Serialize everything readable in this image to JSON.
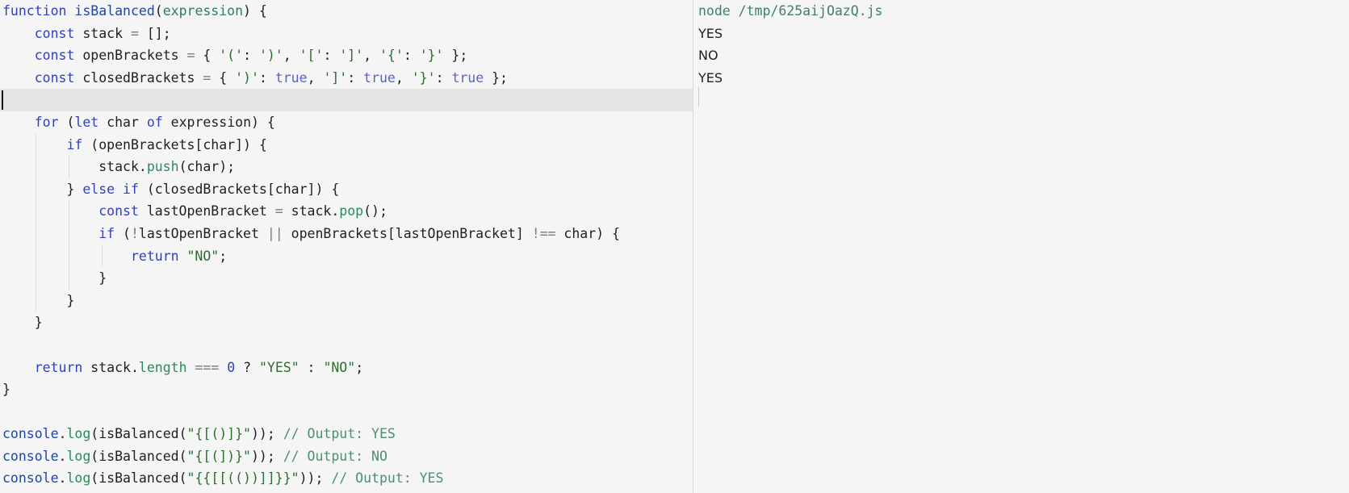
{
  "editor": {
    "lines": [
      [
        [
          "kw",
          "function"
        ],
        [
          "plain",
          " "
        ],
        [
          "fn",
          "isBalanced"
        ],
        [
          "plain",
          "("
        ],
        [
          "param",
          "expression"
        ],
        [
          "plain",
          ") {"
        ]
      ],
      [
        [
          "plain",
          "    "
        ],
        [
          "kw",
          "const"
        ],
        [
          "plain",
          " stack "
        ],
        [
          "op",
          "="
        ],
        [
          "plain",
          " [];"
        ]
      ],
      [
        [
          "plain",
          "    "
        ],
        [
          "kw",
          "const"
        ],
        [
          "plain",
          " openBrackets "
        ],
        [
          "op",
          "="
        ],
        [
          "plain",
          " { "
        ],
        [
          "str",
          "'('"
        ],
        [
          "plain",
          ": "
        ],
        [
          "str",
          "')'"
        ],
        [
          "plain",
          ", "
        ],
        [
          "str",
          "'['"
        ],
        [
          "plain",
          ": "
        ],
        [
          "str",
          "']'"
        ],
        [
          "plain",
          ", "
        ],
        [
          "str",
          "'{'"
        ],
        [
          "plain",
          ": "
        ],
        [
          "str",
          "'}'"
        ],
        [
          "plain",
          " };"
        ]
      ],
      [
        [
          "plain",
          "    "
        ],
        [
          "kw",
          "const"
        ],
        [
          "plain",
          " closedBrackets "
        ],
        [
          "op",
          "="
        ],
        [
          "plain",
          " { "
        ],
        [
          "str",
          "')'"
        ],
        [
          "plain",
          ": "
        ],
        [
          "bool",
          "true"
        ],
        [
          "plain",
          ", "
        ],
        [
          "str",
          "']'"
        ],
        [
          "plain",
          ": "
        ],
        [
          "bool",
          "true"
        ],
        [
          "plain",
          ", "
        ],
        [
          "str",
          "'}'"
        ],
        [
          "plain",
          ": "
        ],
        [
          "bool",
          "true"
        ],
        [
          "plain",
          " };"
        ]
      ],
      [],
      [
        [
          "plain",
          "    "
        ],
        [
          "kw",
          "for"
        ],
        [
          "plain",
          " ("
        ],
        [
          "kw",
          "let"
        ],
        [
          "plain",
          " char "
        ],
        [
          "kw",
          "of"
        ],
        [
          "plain",
          " expression) {"
        ]
      ],
      [
        [
          "plain",
          "        "
        ],
        [
          "kw",
          "if"
        ],
        [
          "plain",
          " (openBrackets[char]) {"
        ]
      ],
      [
        [
          "plain",
          "            stack."
        ],
        [
          "prop",
          "push"
        ],
        [
          "plain",
          "(char);"
        ]
      ],
      [
        [
          "plain",
          "        } "
        ],
        [
          "kw",
          "else"
        ],
        [
          "plain",
          " "
        ],
        [
          "kw",
          "if"
        ],
        [
          "plain",
          " (closedBrackets[char]) {"
        ]
      ],
      [
        [
          "plain",
          "            "
        ],
        [
          "kw",
          "const"
        ],
        [
          "plain",
          " lastOpenBracket "
        ],
        [
          "op",
          "="
        ],
        [
          "plain",
          " stack."
        ],
        [
          "prop",
          "pop"
        ],
        [
          "plain",
          "();"
        ]
      ],
      [
        [
          "plain",
          "            "
        ],
        [
          "kw",
          "if"
        ],
        [
          "plain",
          " ("
        ],
        [
          "op",
          "!"
        ],
        [
          "plain",
          "lastOpenBracket "
        ],
        [
          "op",
          "||"
        ],
        [
          "plain",
          " openBrackets[lastOpenBracket] "
        ],
        [
          "op",
          "!=="
        ],
        [
          "plain",
          " char) {"
        ]
      ],
      [
        [
          "plain",
          "                "
        ],
        [
          "kw",
          "return"
        ],
        [
          "plain",
          " "
        ],
        [
          "str",
          "\"NO\""
        ],
        [
          "plain",
          ";"
        ]
      ],
      [
        [
          "plain",
          "            }"
        ]
      ],
      [
        [
          "plain",
          "        }"
        ]
      ],
      [
        [
          "plain",
          "    }"
        ]
      ],
      [],
      [
        [
          "plain",
          "    "
        ],
        [
          "kw",
          "return"
        ],
        [
          "plain",
          " stack."
        ],
        [
          "prop",
          "length"
        ],
        [
          "plain",
          " "
        ],
        [
          "op",
          "==="
        ],
        [
          "plain",
          " "
        ],
        [
          "num",
          "0"
        ],
        [
          "plain",
          " ? "
        ],
        [
          "str",
          "\"YES\""
        ],
        [
          "plain",
          " : "
        ],
        [
          "str",
          "\"NO\""
        ],
        [
          "plain",
          ";"
        ]
      ],
      [
        [
          "plain",
          "}"
        ]
      ],
      [],
      [
        [
          "fn",
          "console"
        ],
        [
          "plain",
          "."
        ],
        [
          "prop",
          "log"
        ],
        [
          "plain",
          "(isBalanced("
        ],
        [
          "str",
          "\"{[()]}\""
        ],
        [
          "plain",
          "));"
        ],
        [
          "cmt",
          " // Output: YES"
        ]
      ],
      [
        [
          "fn",
          "console"
        ],
        [
          "plain",
          "."
        ],
        [
          "prop",
          "log"
        ],
        [
          "plain",
          "(isBalanced("
        ],
        [
          "str",
          "\"{[(])}\""
        ],
        [
          "plain",
          "));"
        ],
        [
          "cmt",
          " // Output: NO"
        ]
      ],
      [
        [
          "fn",
          "console"
        ],
        [
          "plain",
          "."
        ],
        [
          "prop",
          "log"
        ],
        [
          "plain",
          "(isBalanced("
        ],
        [
          "str",
          "\"{{[[(())]]}}\""
        ],
        [
          "plain",
          "));"
        ],
        [
          "cmt",
          " // Output: YES"
        ]
      ]
    ],
    "current_line": 5
  },
  "output": {
    "command": "node /tmp/625aijOazQ.js",
    "results": [
      "YES",
      "NO",
      "YES"
    ]
  }
}
